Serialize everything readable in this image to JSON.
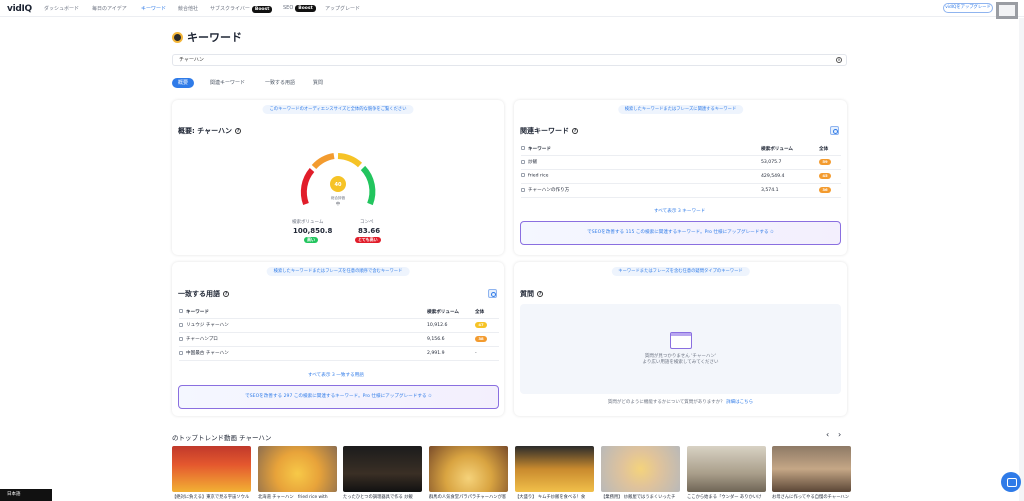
{
  "nav": {
    "logo": "vidIQ",
    "items": [
      "ダッシュボード",
      "毎日のアイデア",
      "キーワード",
      "競合他社",
      "サブスクライバー",
      "SEO",
      "アップグレード"
    ],
    "boost": "Boost",
    "upgrade_pill": "vidIQをアップグレード"
  },
  "page": {
    "title": "キーワード",
    "search_value": "チャーハン",
    "tabs": [
      "概要",
      "関連キーワード",
      "一致する用語",
      "質問"
    ]
  },
  "overview": {
    "pill": "このキーワードのオーディエンスサイズと全体的な競争をご覧ください",
    "title": "概要: チャーハン",
    "score": "40",
    "score_label": "総合評価",
    "score_level": "中",
    "volume_label": "検索ボリューム",
    "volume_value": "100,850.8",
    "volume_badge": "高い",
    "comp_label": "コンペ",
    "comp_value": "83.66",
    "comp_badge": "とても高い"
  },
  "related": {
    "pill": "検索したキーワードまたはフレーズに関連するキーワード",
    "title": "関連キーワード",
    "col_keyword": "キーワード",
    "col_volume": "検索ボリューム",
    "col_total": "全体",
    "rows": [
      {
        "keyword": "炒飯",
        "volume": "53,075.7",
        "score": "59"
      },
      {
        "keyword": "fried rice",
        "volume": "429,549.4",
        "score": "45"
      },
      {
        "keyword": "チャーハンの作り方",
        "volume": "3,574.1",
        "score": "36"
      }
    ],
    "see_all": "すべて表示 3 キーワード",
    "promo": "でSEOを改善する 115 この検索に関連するキーワード。Pro 仕様にアップグレードする ✩"
  },
  "matching": {
    "pill": "検索したキーワードまたはフレーズを任意の順序で含むキーワード",
    "title": "一致する用語",
    "col_keyword": "キーワード",
    "col_volume": "検索ボリューム",
    "col_total": "全体",
    "rows": [
      {
        "keyword": "リュウジ チャーハン",
        "volume": "10,912.6",
        "score": "47"
      },
      {
        "keyword": "チャーハンプロ",
        "volume": "9,156.6",
        "score": "38"
      },
      {
        "keyword": "中国最古 チャーハン",
        "volume": "2,991.9",
        "score": "-"
      }
    ],
    "see_all": "すべて表示 3 一致する用語",
    "promo": "でSEOを改善する 297 この検索に関連するキーワード。Pro 仕様にアップグレードする ✩"
  },
  "questions": {
    "pill": "キーワードまたはフレーズを含む任意の疑問タイプのキーワード",
    "title": "質問",
    "empty_line1": "質問が見つかりません 'チャーハン'",
    "empty_line2": "より広い用語を検索してみてください",
    "footer": "質問がどのように機能するかについて質問がありますか？",
    "footer_link": "詳細はこちら"
  },
  "trending": {
    "title": "のトップトレンド動画 チャーハン",
    "captions": [
      "【絶対に負える】東京で見る宇宙ソウル",
      "北海道 チャーハン　fried rice with",
      "たったひとつの調理器具で作る 炒飯",
      "群馬の人気食堂パラパラチャーハンが客",
      "【大盛り】 キムチ炒飯を食べる！食",
      "【業務用】 炒飯屋ではうまくいったチ",
      "ここから始まる「ウンダー ありかいけ",
      "お母さんに作ってやる自慢のチャーハン"
    ]
  },
  "colors": {
    "accent": "#2f7be8",
    "promo_border": "#8a6fe0",
    "green": "#22c55e",
    "orange": "#f39b2f",
    "red": "#e11d2a"
  },
  "footer": {
    "language": "日本語"
  }
}
